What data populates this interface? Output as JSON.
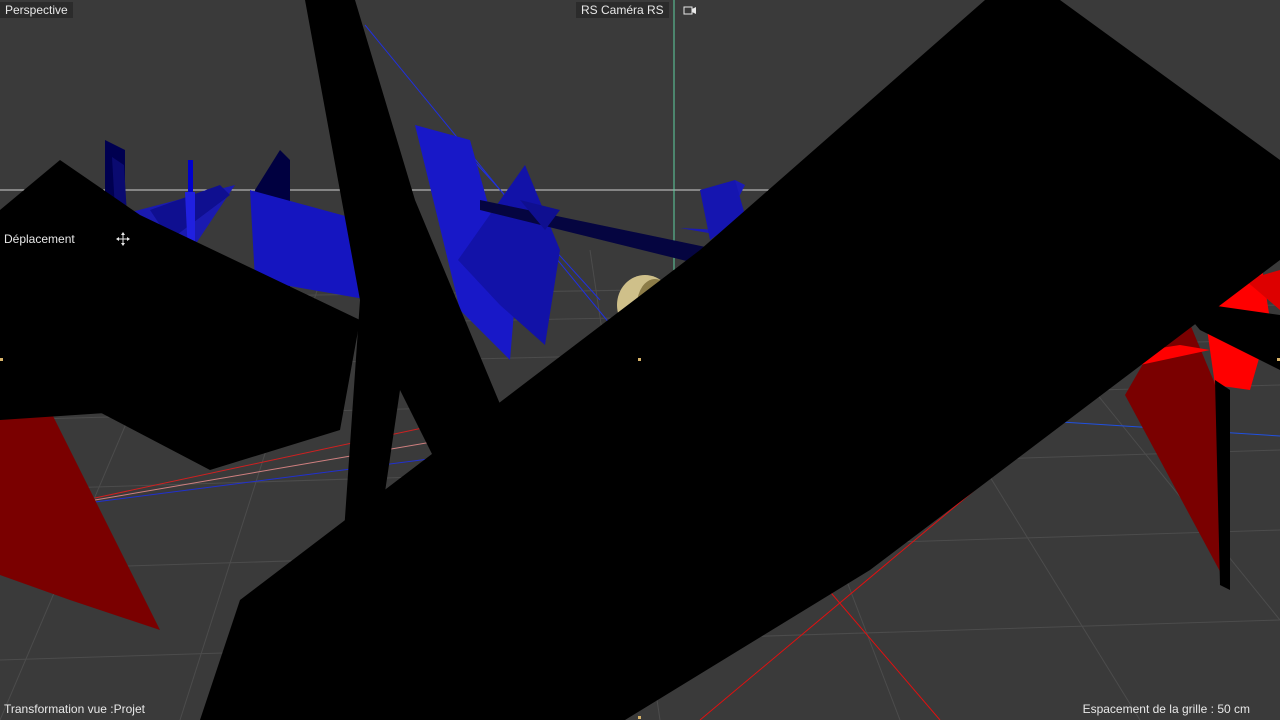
{
  "viewport": {
    "view_mode": "Perspective",
    "camera": "RS Caméra RS",
    "tool_hint": "Déplacement",
    "transform": "Transformation vue :Projet",
    "grid_spacing": "Espacement de la grille : 50 cm"
  },
  "icons": {
    "camera": "camera-icon",
    "move": "move-cross-icon"
  },
  "colors": {
    "background": "#3a3a3a",
    "grid": "#4a4a4a",
    "blue_objects": "#1010c8",
    "red_objects": "#e00000",
    "dark_objects": "#000000",
    "horizon_line": "#d8d8d8",
    "camera_guide": "#5fd0a0"
  }
}
